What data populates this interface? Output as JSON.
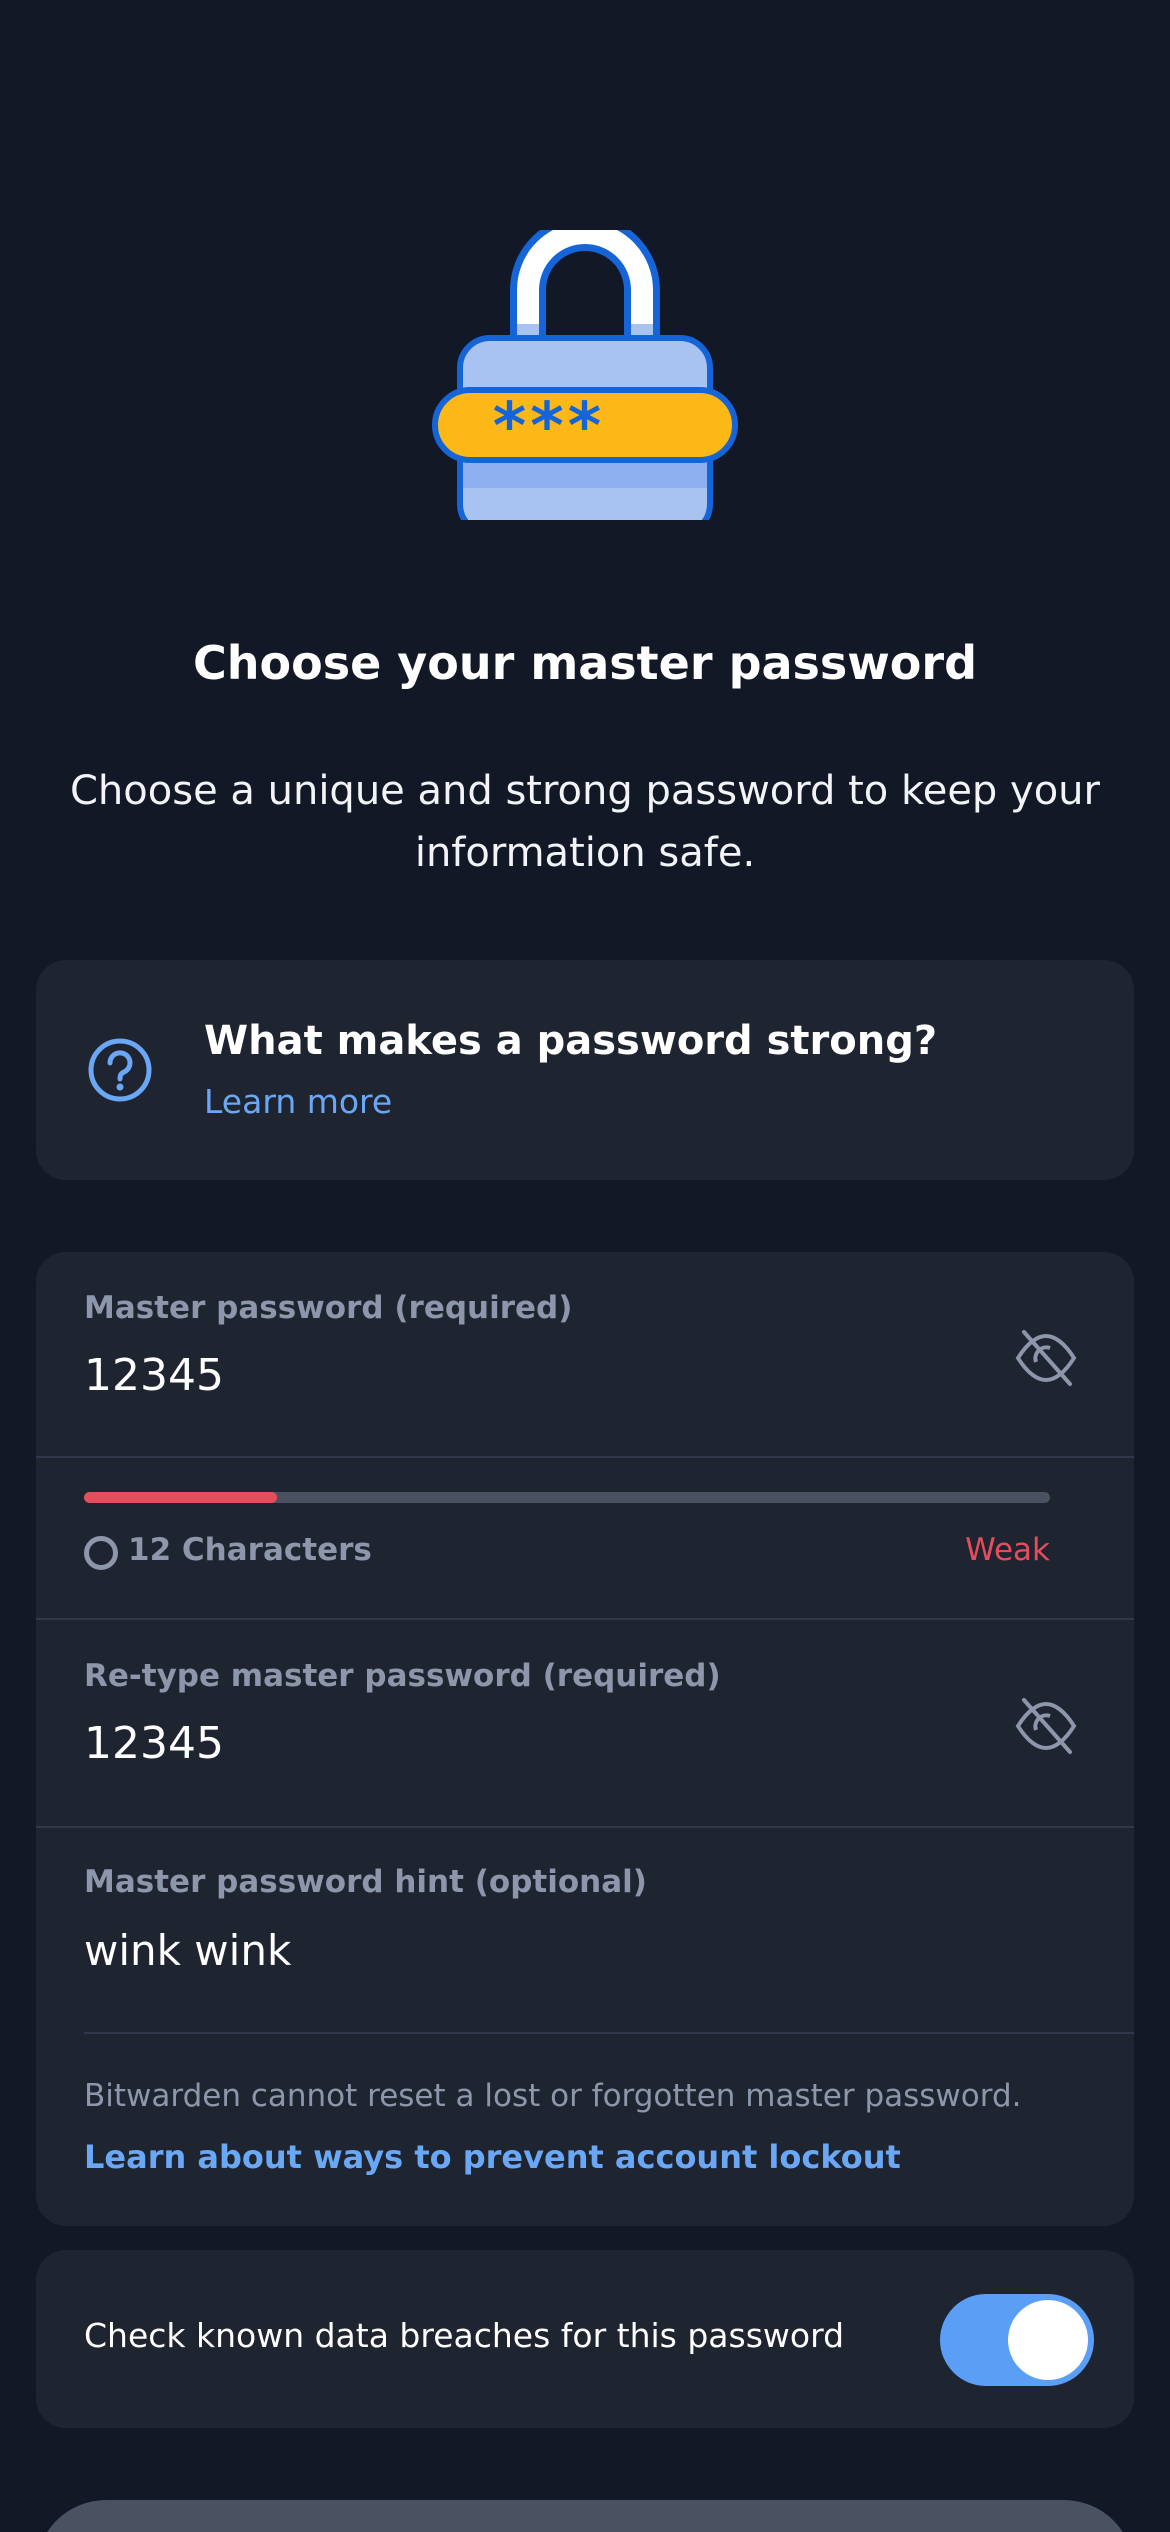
{
  "header": {
    "title": "Choose your master password",
    "subtitle": "Choose a unique and strong password to keep your information safe."
  },
  "illustration": {
    "icon": "lock-password-illustration",
    "text": "***__"
  },
  "tip": {
    "icon": "help-circle-icon",
    "title": "What makes a password strong?",
    "link": "Learn more"
  },
  "master_password": {
    "label": "Master password (required)",
    "value": "12345",
    "visibility_icon": "eye-slash-icon"
  },
  "strength": {
    "requirement": "12 Characters",
    "rating": "Weak",
    "fill_fraction": 0.2,
    "color": "#e64d5c"
  },
  "retype_password": {
    "label": "Re-type master password (required)",
    "value": "12345",
    "visibility_icon": "eye-slash-icon"
  },
  "hint": {
    "label": "Master password hint (optional)",
    "value": "wink wink"
  },
  "warning": {
    "text": "Bitwarden cannot reset a lost or forgotten master password.",
    "link": "Learn about ways to prevent account lockout"
  },
  "breach_check": {
    "label": "Check known data breaches for this password",
    "enabled": true
  },
  "colors": {
    "background": "#121825",
    "card": "#1f2431",
    "accent": "#6aa8f5",
    "danger": "#e64d5c"
  }
}
